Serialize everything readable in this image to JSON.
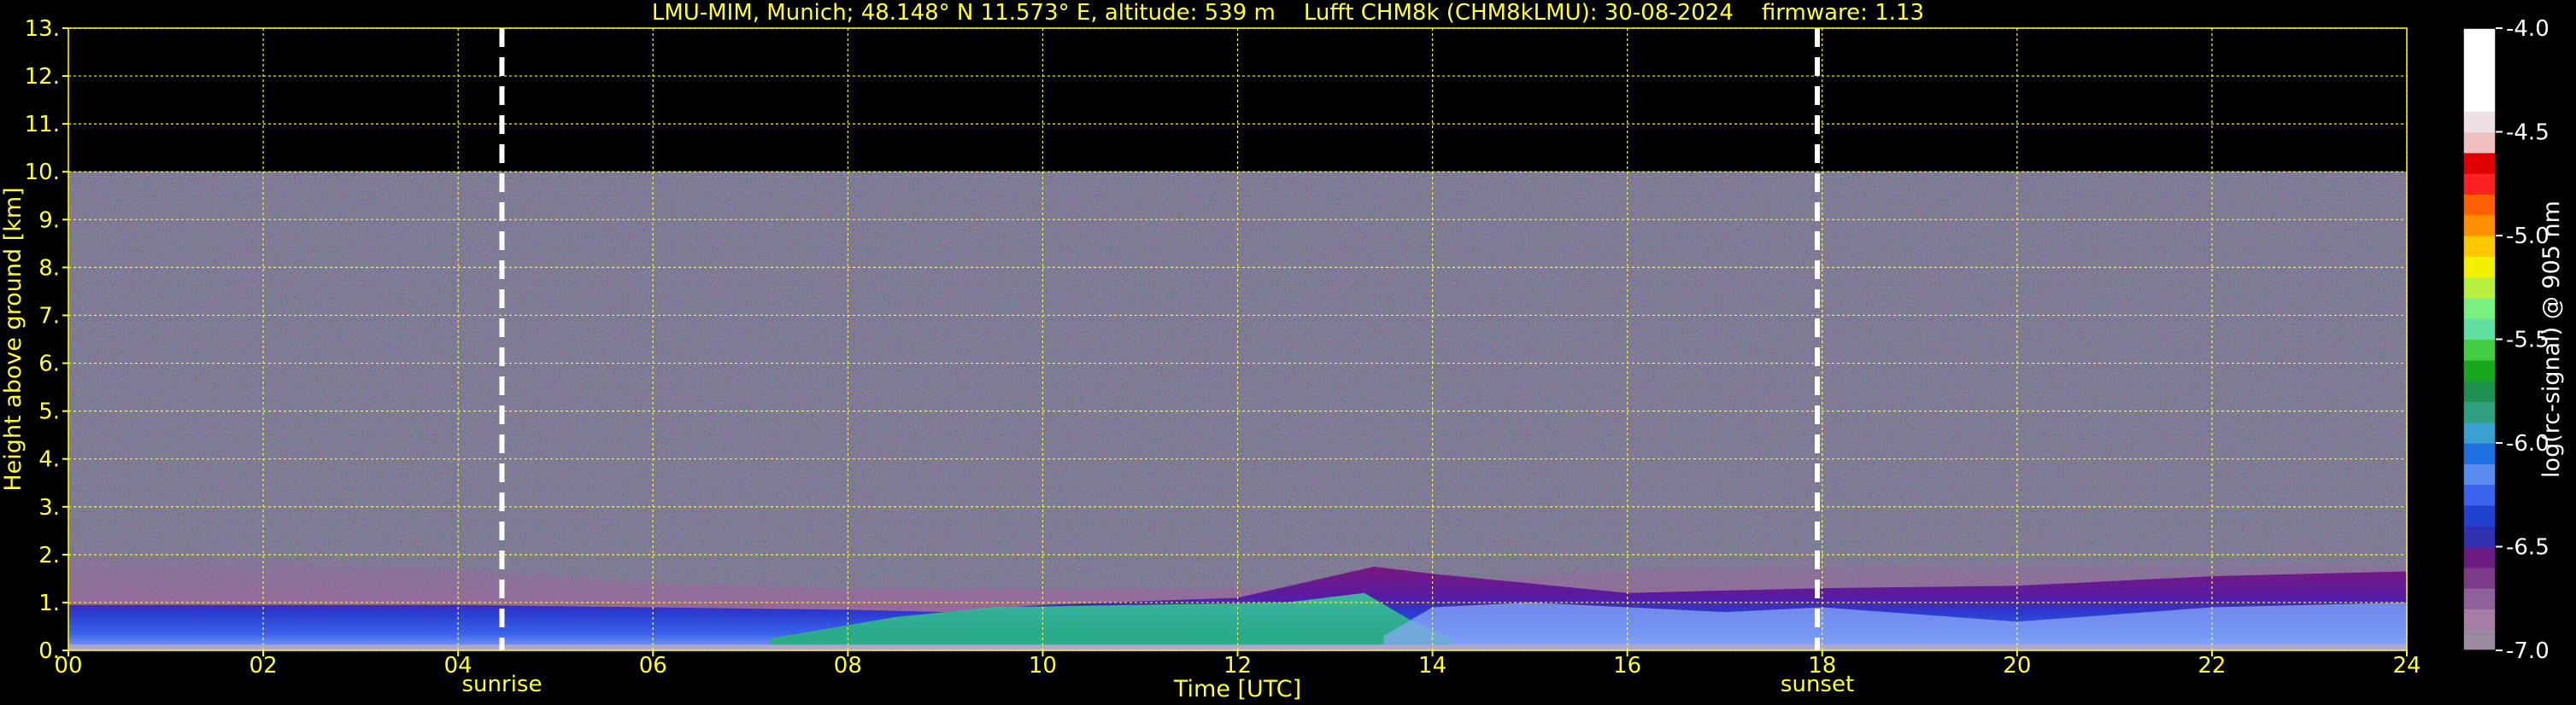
{
  "title": "LMU-MIM, Munich; 48.148° N 11.573° E, altitude: 539 m    Lufft CHM8k (CHM8kLMU): 30-08-2024    firmware: 1.13",
  "colors": {
    "text": "#ffff33",
    "grid": "#ffff00",
    "background": "#000000",
    "marker": "#ffffff"
  },
  "chart_data": {
    "type": "heatmap",
    "xlabel": "Time [UTC]",
    "ylabel": "Height above ground [km]",
    "xlim": [
      0,
      24
    ],
    "ylim": [
      0,
      13
    ],
    "x_ticks": [
      "00",
      "02",
      "04",
      "06",
      "08",
      "10",
      "12",
      "14",
      "16",
      "18",
      "20",
      "22",
      "24"
    ],
    "y_ticks": [
      "0.",
      "1.",
      "2.",
      "3.",
      "4.",
      "5.",
      "6.",
      "7.",
      "8.",
      "9.",
      "10.",
      "11.",
      "12.",
      "13."
    ],
    "grid": true,
    "data_top_km": 10,
    "markers": [
      {
        "label": "sunrise",
        "x": 4.45
      },
      {
        "label": "sunset",
        "x": 17.95
      }
    ],
    "colorbar": {
      "label": "log(rc-signal) @ 905 nm",
      "range": [
        -7.0,
        -4.0
      ],
      "ticks": [
        "-4.0",
        "-4.5",
        "-5.0",
        "-5.5",
        "-6.0",
        "-6.5",
        "-7.0"
      ],
      "colors": [
        "#9a8aa0",
        "#a47ea6",
        "#8e6298",
        "#7c3a88",
        "#6a1a80",
        "#3030b0",
        "#2040d0",
        "#3a62ea",
        "#5a8cf0",
        "#1e70e0",
        "#3aa0d0",
        "#30a080",
        "#1f9050",
        "#18a820",
        "#44cc44",
        "#60e0a0",
        "#7af080",
        "#b8f040",
        "#f0f000",
        "#ffc800",
        "#ff9000",
        "#ff6000",
        "#ff2020",
        "#e00000",
        "#f0c0c0",
        "#eee0e4",
        "#ffffff",
        "#ffffff",
        "#ffffff",
        "#ffffff"
      ]
    },
    "boundary_layer_top_km": [
      [
        0,
        0.95
      ],
      [
        2,
        0.95
      ],
      [
        4,
        0.95
      ],
      [
        6,
        0.9
      ],
      [
        8,
        0.85
      ],
      [
        9,
        0.8
      ],
      [
        10,
        0.95
      ],
      [
        12,
        1.1
      ],
      [
        13.4,
        1.75
      ],
      [
        14,
        1.6
      ],
      [
        16,
        1.2
      ],
      [
        18,
        1.3
      ],
      [
        20,
        1.35
      ],
      [
        22,
        1.55
      ],
      [
        24,
        1.65
      ]
    ],
    "aerosol_layer_top_km": [
      [
        0,
        2.0
      ],
      [
        2,
        1.9
      ],
      [
        4,
        1.7
      ],
      [
        6,
        1.4
      ],
      [
        8,
        1.3
      ],
      [
        10,
        1.3
      ],
      [
        12,
        1.3
      ],
      [
        14,
        1.4
      ],
      [
        16,
        1.7
      ],
      [
        18,
        1.8
      ],
      [
        20,
        1.8
      ],
      [
        22,
        1.8
      ],
      [
        24,
        1.8
      ]
    ]
  }
}
